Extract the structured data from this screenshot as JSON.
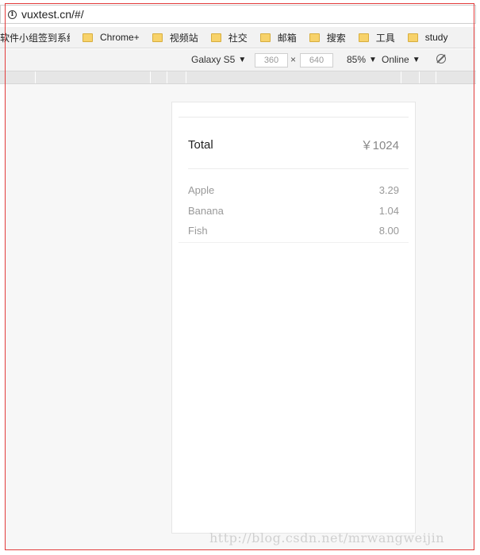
{
  "browser": {
    "url": "vuxtest.cn/#/"
  },
  "bookmarks": [
    {
      "label": "软件小组签到系统"
    },
    {
      "label": "Chrome+"
    },
    {
      "label": "视频站"
    },
    {
      "label": "社交"
    },
    {
      "label": "邮箱"
    },
    {
      "label": "搜索"
    },
    {
      "label": "工具"
    },
    {
      "label": "study"
    }
  ],
  "device_toolbar": {
    "device": "Galaxy S5",
    "width": "360",
    "height": "640",
    "times": "×",
    "zoom": "85%",
    "network": "Online"
  },
  "summary": {
    "total_label": "Total",
    "total_value": "￥1024",
    "items": [
      {
        "name": "Apple",
        "value": "3.29"
      },
      {
        "name": "Banana",
        "value": "1.04"
      },
      {
        "name": "Fish",
        "value": "8.00"
      }
    ]
  },
  "watermark": "http://blog.csdn.net/mrwangweijin"
}
